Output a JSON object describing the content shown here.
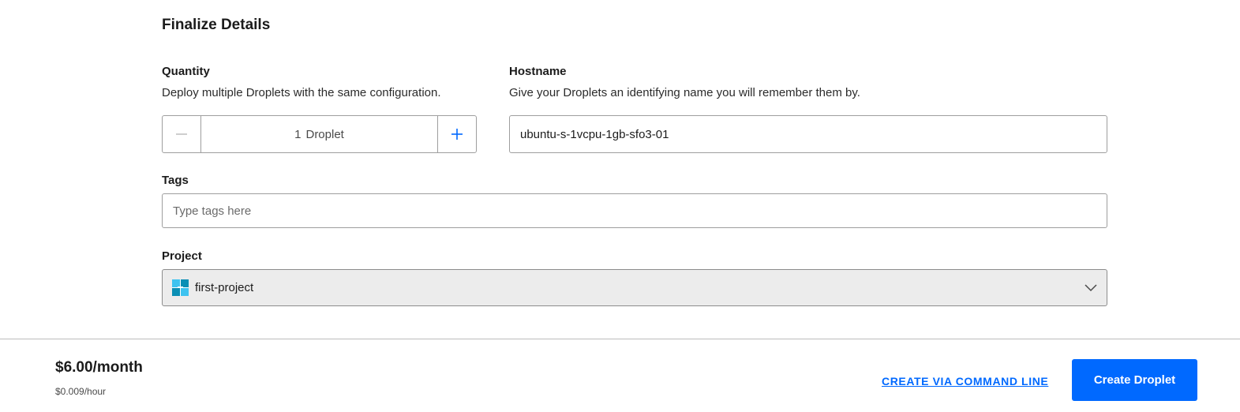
{
  "section": {
    "title": "Finalize Details"
  },
  "quantity": {
    "label": "Quantity",
    "description": "Deploy multiple Droplets with the same configuration.",
    "count": "1",
    "unit": "Droplet"
  },
  "hostname": {
    "label": "Hostname",
    "description": "Give your Droplets an identifying name you will remember them by.",
    "value": "ubuntu-s-1vcpu-1gb-sfo3-01"
  },
  "tags": {
    "label": "Tags",
    "placeholder": "Type tags here"
  },
  "project": {
    "label": "Project",
    "selected": "first-project"
  },
  "footer": {
    "price_month": "$6.00/month",
    "price_hour": "$0.009/hour",
    "cli_link": "CREATE VIA COMMAND LINE",
    "create_button": "Create Droplet"
  },
  "colors": {
    "accent": "#0069ff",
    "text": "#1b1b1b",
    "select_bg": "#ececec"
  },
  "icons": {
    "minus": "minus-icon",
    "plus": "plus-icon",
    "project": "project-icon",
    "chevron": "chevron-down-icon"
  }
}
